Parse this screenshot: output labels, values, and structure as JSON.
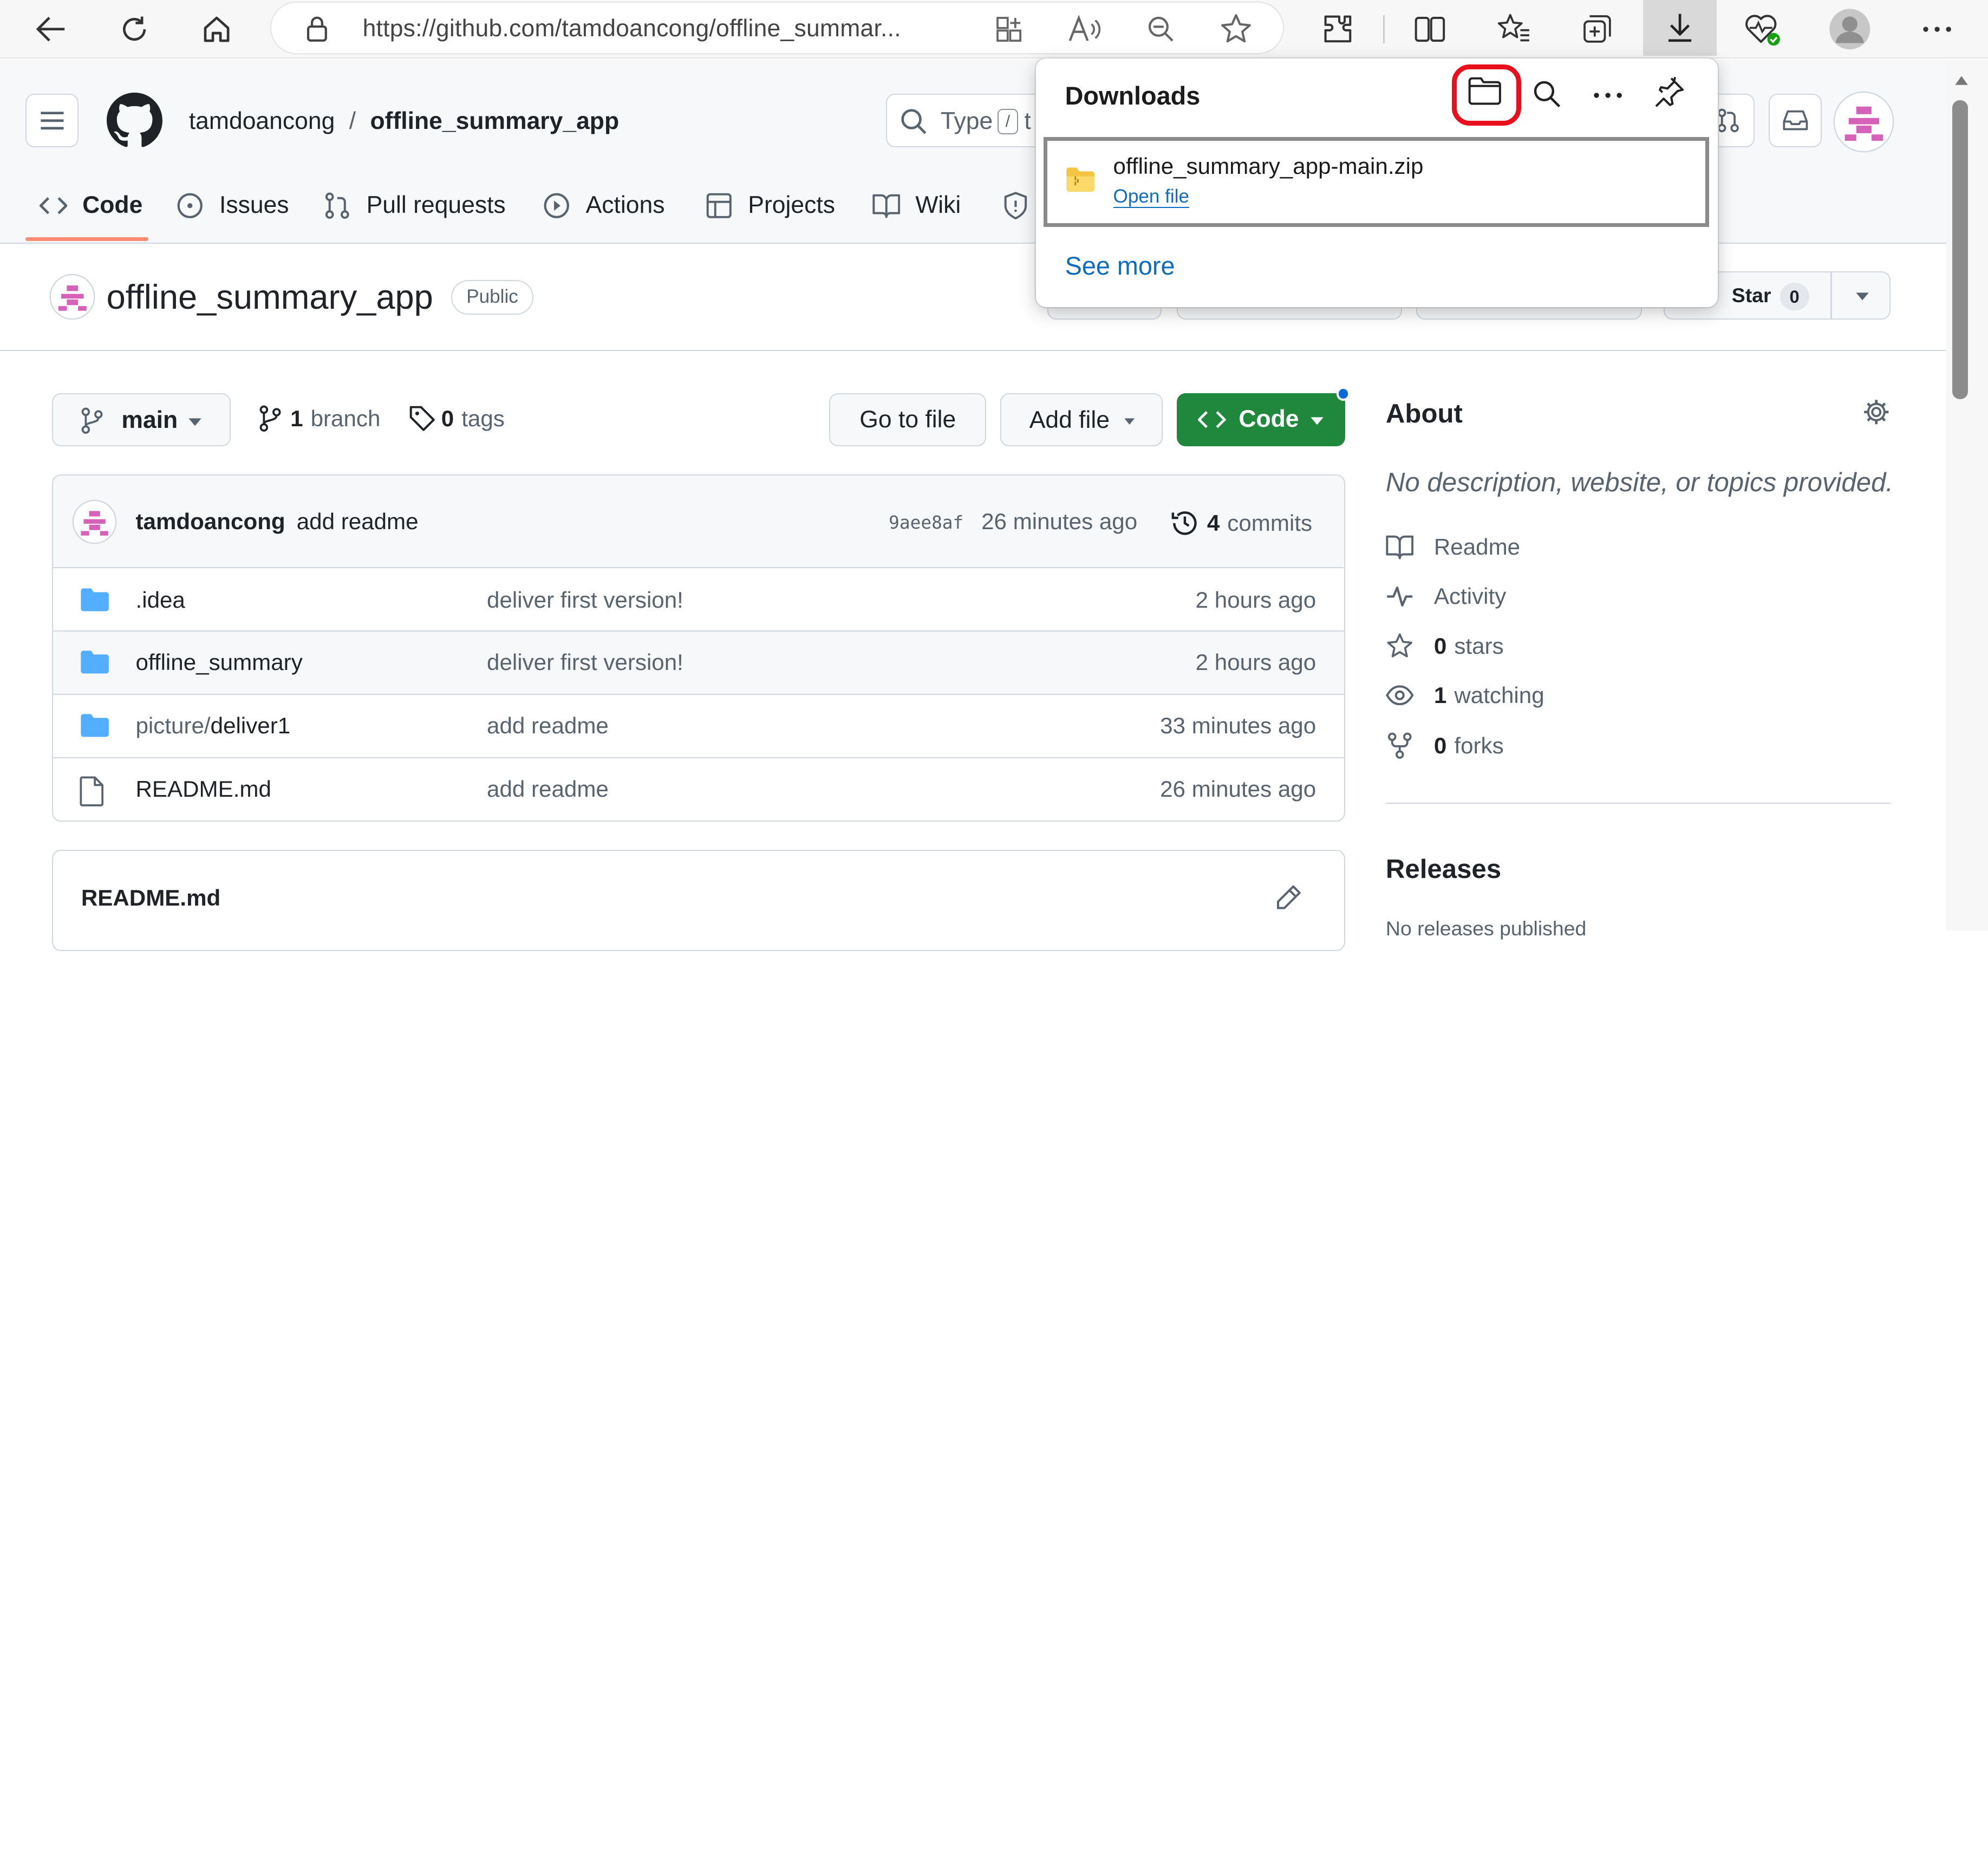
{
  "browser": {
    "url": "https://github.com/tamdoancong/offline_summar..."
  },
  "header": {
    "owner": "tamdoancong",
    "separator": "/",
    "repo": "offline_summary_app",
    "search_placeholder": "Type",
    "search_key": "/",
    "search_tail": "t"
  },
  "tabs": [
    {
      "label": "Code"
    },
    {
      "label": "Issues"
    },
    {
      "label": "Pull requests"
    },
    {
      "label": "Actions"
    },
    {
      "label": "Projects"
    },
    {
      "label": "Wiki"
    }
  ],
  "repo_head": {
    "name": "offline_summary_app",
    "visibility": "Public",
    "star_label": "Star",
    "star_count": "0"
  },
  "toolbar": {
    "branch": "main",
    "branch_count": "1",
    "branch_label": "branch",
    "tag_count": "0",
    "tag_label": "tags",
    "goto_file": "Go to file",
    "add_file": "Add file",
    "code": "Code"
  },
  "commit": {
    "author": "tamdoancong",
    "message": "add readme",
    "hash": "9aee8af",
    "time": "26 minutes ago",
    "count": "4",
    "count_label": "commits"
  },
  "files": [
    {
      "name": ".idea",
      "type": "folder",
      "message": "deliver first version!",
      "time": "2 hours ago"
    },
    {
      "name": "offline_summary",
      "type": "folder",
      "message": "deliver first version!",
      "time": "2 hours ago"
    },
    {
      "name_prefix": "picture/",
      "name": "deliver1",
      "type": "folder",
      "message": "add readme",
      "time": "33 minutes ago"
    },
    {
      "name": "README.md",
      "type": "file",
      "message": "add readme",
      "time": "26 minutes ago"
    }
  ],
  "readme": {
    "title": "README.md"
  },
  "about": {
    "heading": "About",
    "description": "No description, website, or topics provided.",
    "readme": "Readme",
    "activity": "Activity",
    "stars_count": "0",
    "stars_label": "stars",
    "watching_count": "1",
    "watching_label": "watching",
    "forks_count": "0",
    "forks_label": "forks",
    "releases_heading": "Releases",
    "releases_note": "No releases published"
  },
  "downloads": {
    "title": "Downloads",
    "file_name": "offline_summary_app-main.zip",
    "open_file": "Open file",
    "see_more": "See more"
  },
  "colors": {
    "accent_blue": "#0969da",
    "green_button": "#1f883d",
    "folder_blue": "#54aeff",
    "highlight_red": "#e8101c",
    "tab_underline": "#fd8c73"
  }
}
